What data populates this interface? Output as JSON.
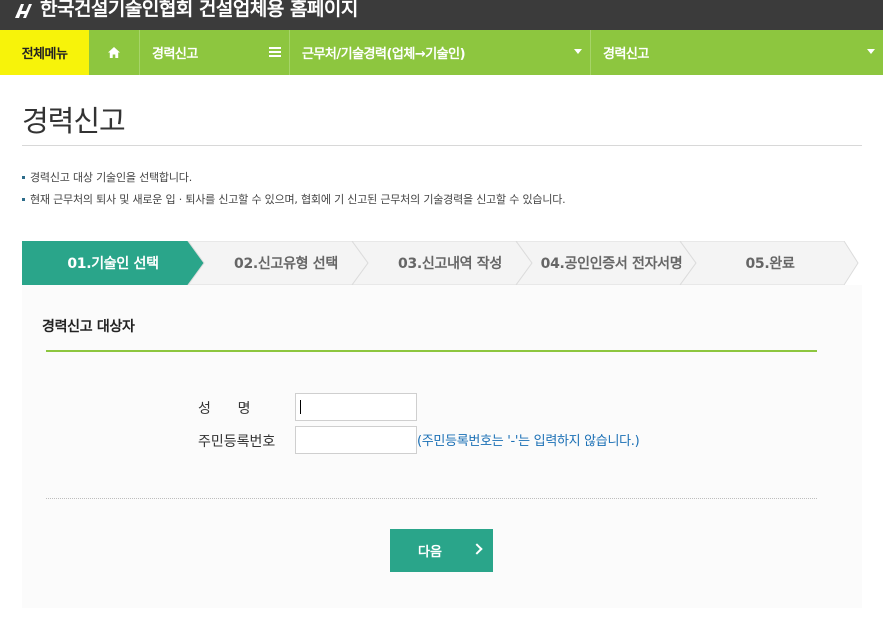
{
  "titlebar": {
    "logo_icon": "kocea-logo-icon",
    "title": "한국건설기술인협회 건설업체용 홈페이지"
  },
  "nav": {
    "all_menu": "전체메뉴",
    "home_icon": "home-icon",
    "menu_icon": "hamburger-icon",
    "item1": "경력신고",
    "item2": "근무처/기술경력(업체→기술인)",
    "item3": "경력신고"
  },
  "page": {
    "title": "경력신고",
    "notes": [
      "경력신고 대상 기술인을 선택합니다.",
      "현재 근무처의 퇴사 및 새로운 입 · 퇴사를 신고할 수 있으며, 협회에 기 신고된 근무처의 기술경력을 신고할 수 있습니다."
    ]
  },
  "steps": [
    {
      "label": "01.기술인 선택",
      "active": true
    },
    {
      "label": "02.신고유형 선택",
      "active": false
    },
    {
      "label": "03.신고내역 작성",
      "active": false
    },
    {
      "label": "04.공인인증서 전자서명",
      "active": false
    },
    {
      "label": "05.완료",
      "active": false
    }
  ],
  "form": {
    "section_title": "경력신고 대상자",
    "name_label": "성      명",
    "name_value": "",
    "rrn_label": "주민등록번호",
    "rrn_value": "",
    "rrn_hint": "(주민등록번호는 '-'는 입력하지 않습니다.)",
    "next_label": "다음"
  },
  "colors": {
    "nav_green": "#8dc63f",
    "all_menu_yellow": "#f7f30a",
    "accent_teal": "#2aa58a",
    "titlebar": "#3b3b3b",
    "hint_blue": "#1a6fb5"
  }
}
